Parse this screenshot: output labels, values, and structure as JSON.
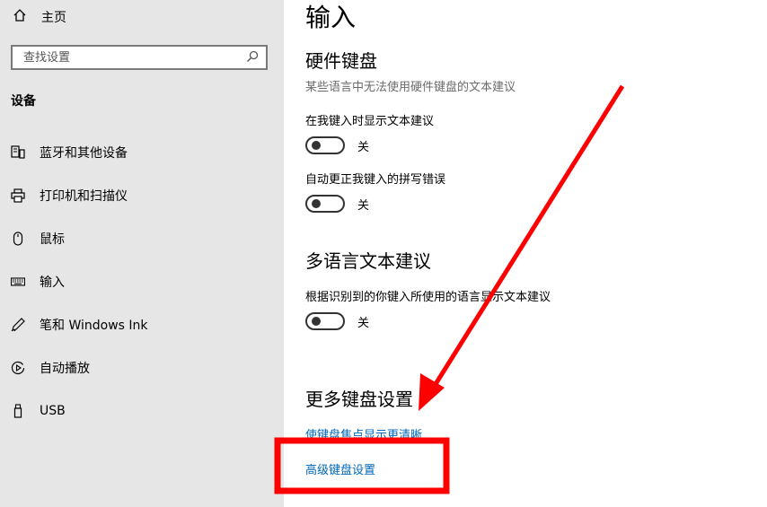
{
  "sidebar": {
    "home_label": "主页",
    "search_placeholder": "查找设置",
    "section_title": "设备",
    "items": [
      {
        "label": "蓝牙和其他设备",
        "icon": "bluetooth-devices-icon"
      },
      {
        "label": "打印机和扫描仪",
        "icon": "printer-icon"
      },
      {
        "label": "鼠标",
        "icon": "mouse-icon"
      },
      {
        "label": "输入",
        "icon": "keyboard-icon"
      },
      {
        "label": "笔和 Windows Ink",
        "icon": "pen-icon"
      },
      {
        "label": "自动播放",
        "icon": "autoplay-icon"
      },
      {
        "label": "USB",
        "icon": "usb-icon"
      }
    ]
  },
  "main": {
    "title": "输入",
    "hardware_keyboard": {
      "heading": "硬件键盘",
      "description": "某些语言中无法使用硬件键盘的文本建议",
      "option1_label": "在我键入时显示文本建议",
      "option1_state": "关",
      "option2_label": "自动更正我键入的拼写错误",
      "option2_state": "关"
    },
    "multilingual": {
      "heading": "多语言文本建议",
      "option_label": "根据识别到的你键入所使用的语言显示文本建议",
      "option_state": "关"
    },
    "more_keyboard": {
      "heading": "更多键盘设置",
      "link1": "使键盘焦点显示更清晰",
      "link2": "高级键盘设置"
    }
  },
  "annotation": {
    "color": "#ff0000"
  }
}
